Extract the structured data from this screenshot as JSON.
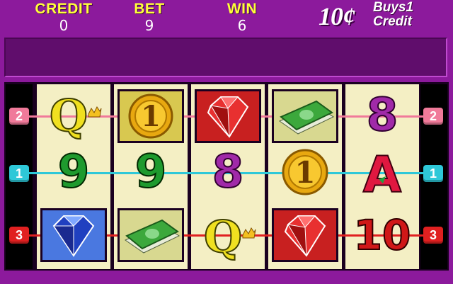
{
  "header": {
    "credit_label": "CREDIT",
    "credit_value": "0",
    "bet_label": "BET",
    "bet_value": "9",
    "win_label": "WIN",
    "win_value": "6",
    "denomination": "10¢",
    "denomination_note_1": "Buys1",
    "denomination_note_2": "Credit"
  },
  "paylines": [
    {
      "number": "2",
      "color": "#f07a9a"
    },
    {
      "number": "1",
      "color": "#2ec8d8"
    },
    {
      "number": "3",
      "color": "#e02020"
    }
  ],
  "reels": [
    [
      "Q",
      "9",
      "blue-diamond"
    ],
    [
      "gold-coin-1",
      "9",
      "cash-stack"
    ],
    [
      "red-ruby",
      "8",
      "Q"
    ],
    [
      "cash-stack",
      "gold-coin-1",
      "red-ruby"
    ],
    [
      "8",
      "A",
      "10"
    ]
  ],
  "symbol_text": {
    "Q": "Q",
    "nine": "9",
    "eight": "8",
    "A": "A",
    "ten": "10",
    "coin": "1"
  },
  "colors": {
    "cabinet": "#8c1a9c",
    "reel_bg": "#f4efc4",
    "label_yellow": "#ffff3a"
  }
}
